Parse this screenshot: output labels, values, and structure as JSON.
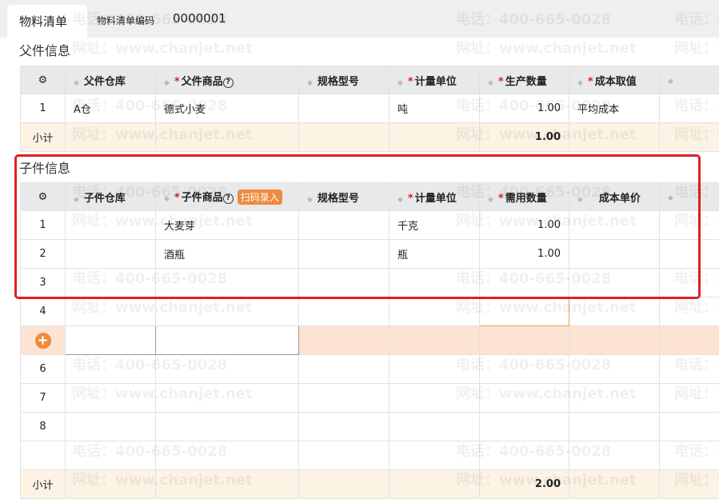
{
  "header": {
    "tab": "物料清单",
    "code_label": "物料清单编码",
    "code_value": "0000001"
  },
  "parent": {
    "title": "父件信息",
    "columns": [
      "父件仓库",
      "父件商品",
      "规格型号",
      "计量单位",
      "生产数量",
      "成本取值"
    ],
    "row": {
      "no": "1",
      "warehouse": "A仓",
      "product": "德式小麦",
      "spec": "",
      "unit": "吨",
      "qty": "1.00",
      "cost": "平均成本"
    },
    "subtotal_label": "小计",
    "subtotal_qty": "1.00"
  },
  "child": {
    "title": "子件信息",
    "scan_label": "扫码录入",
    "columns": [
      "子件仓库",
      "子件商品",
      "规格型号",
      "计量单位",
      "需用数量",
      "成本单价"
    ],
    "rows": [
      {
        "no": "1",
        "product": "大麦芽",
        "unit": "千克",
        "qty": "1.00"
      },
      {
        "no": "2",
        "product": "酒瓶",
        "unit": "瓶",
        "qty": "1.00"
      },
      {
        "no": "3"
      },
      {
        "no": "4"
      },
      {
        "no": "6"
      },
      {
        "no": "7"
      },
      {
        "no": "8"
      }
    ],
    "subtotal_label": "小计",
    "subtotal_qty": "2.00"
  },
  "watermark": {
    "phone": "电话：400-665-0028",
    "site": "网址：www.chanjet.net"
  }
}
